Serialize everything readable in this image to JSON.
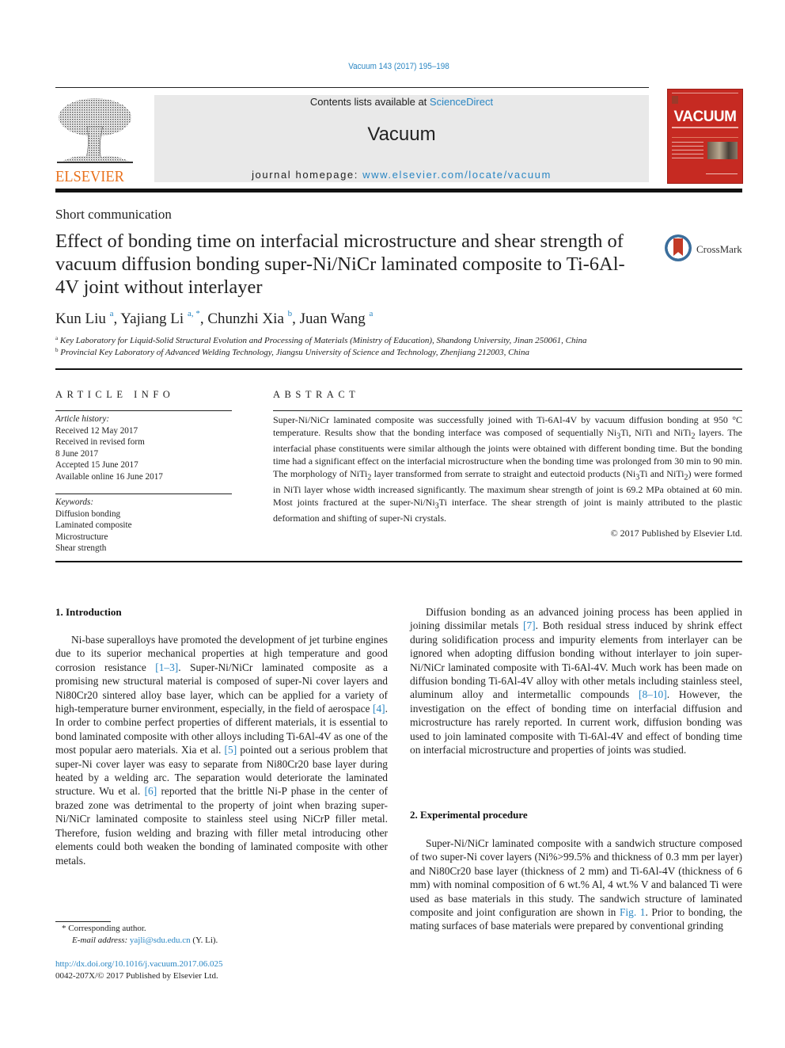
{
  "header": {
    "citation": "Vacuum 143 (2017) 195–198",
    "contents_prefix": "Contents lists available at ",
    "contents_link": "ScienceDirect",
    "journal_name": "Vacuum",
    "homepage_prefix": "journal homepage: ",
    "homepage_link": "www.elsevier.com/locate/vacuum",
    "publisher_wordmark": "ELSEVIER",
    "cover_title": "VACUUM",
    "crossmark_label": "CrossMark"
  },
  "colors": {
    "link": "#2a86c3",
    "elsevier_orange": "#e9711c",
    "cover_red": "#c62a22",
    "masthead_gray": "#e9e9e9"
  },
  "article": {
    "section_type": "Short communication",
    "title": "Effect of bonding time on interfacial microstructure and shear strength of vacuum diffusion bonding super-Ni/NiCr laminated composite to Ti-6Al-4V joint without interlayer",
    "authors": [
      {
        "name": "Kun Liu",
        "sup": "a"
      },
      {
        "name": "Yajiang Li",
        "sup": "a, *"
      },
      {
        "name": "Chunzhi Xia",
        "sup": "b"
      },
      {
        "name": "Juan Wang",
        "sup": "a"
      }
    ],
    "affiliations": [
      {
        "mark": "a",
        "text": "Key Laboratory for Liquid-Solid Structural Evolution and Processing of Materials (Ministry of Education), Shandong University, Jinan 250061, China"
      },
      {
        "mark": "b",
        "text": "Provincial Key Laboratory of Advanced Welding Technology, Jiangsu University of Science and Technology, Zhenjiang 212003, China"
      }
    ]
  },
  "article_info": {
    "heading": "ARTICLE INFO",
    "history_label": "Article history:",
    "history": [
      "Received 12 May 2017",
      "Received in revised form",
      "8 June 2017",
      "Accepted 15 June 2017",
      "Available online 16 June 2017"
    ],
    "keywords_label": "Keywords:",
    "keywords": [
      "Diffusion bonding",
      "Laminated composite",
      "Microstructure",
      "Shear strength"
    ]
  },
  "abstract": {
    "heading": "ABSTRACT",
    "parts": [
      "Super-Ni/NiCr laminated composite was successfully joined with Ti-6Al-4V by vacuum diffusion bonding at 950 °C temperature. Results show that the bonding interface was composed of sequentially Ni",
      "3",
      "Ti, NiTi and NiTi",
      "2",
      " layers. The interfacial phase constituents were similar although the joints were obtained with different bonding time. But the bonding time had a significant effect on the interfacial microstructure when the bonding time was prolonged from 30 min to 90 min. The morphology of NiTi",
      "2",
      " layer transformed from serrate to straight and eutectoid products (Ni",
      "3",
      "Ti and NiTi",
      "2",
      ") were formed in NiTi layer whose width increased significantly. The maximum shear strength of joint is 69.2 MPa obtained at 60 min. Most joints fractured at the super-Ni/Ni",
      "3",
      "Ti interface. The shear strength of joint is mainly attributed to the plastic deformation and shifting of super-Ni crystals."
    ],
    "copyright": "© 2017 Published by Elsevier Ltd."
  },
  "body": {
    "section1_heading": "1.  Introduction",
    "intro": [
      "Ni-base superalloys have promoted the development of jet turbine engines due to its superior mechanical properties at high temperature and good corrosion resistance ",
      "[1–3]",
      ". Super-Ni/NiCr laminated composite as a promising new structural material is composed of super-Ni cover layers and Ni80Cr20 sintered alloy base layer, which can be applied for a variety of high-temperature burner environment, especially, in the field of aerospace ",
      "[4]",
      ". In order to combine perfect properties of different materials, it is essential to bond laminated composite with other alloys including Ti-6Al-4V as one of the most popular aero materials. Xia et al. ",
      "[5]",
      " pointed out a serious problem that super-Ni cover layer was easy to separate from Ni80Cr20 base layer during heated by a welding arc. The separation would deteriorate the laminated structure. Wu et al. ",
      "[6]",
      " reported that the brittle Ni-P phase in the center of brazed zone was detrimental to the property of joint when brazing super-Ni/NiCr laminated composite to stainless steel using NiCrP filler metal. Therefore, fusion welding and brazing with filler metal introducing other elements could both weaken the bonding of laminated composite with other metals."
    ],
    "diffusion": [
      "Diffusion bonding as an advanced joining process has been applied in joining dissimilar metals ",
      "[7]",
      ". Both residual stress induced by shrink effect during solidification process and impurity elements from interlayer can be ignored when adopting diffusion bonding without interlayer to join super-Ni/NiCr laminated composite with Ti-6Al-4V. Much work has been made on diffusion bonding Ti-6Al-4V alloy with other metals including stainless steel, aluminum alloy and intermetallic compounds ",
      "[8–10]",
      ". However, the investigation on the effect of bonding time on interfacial diffusion and microstructure has rarely reported. In current work, diffusion bonding was used to join laminated composite with Ti-6Al-4V and effect of bonding time on interfacial microstructure and properties of joints was studied."
    ],
    "section2_heading": "2.  Experimental procedure",
    "experimental": [
      "Super-Ni/NiCr laminated composite with a sandwich structure composed of two super-Ni cover layers (Ni%>99.5% and thickness of 0.3 mm per layer) and Ni80Cr20 base layer (thickness of 2 mm) and Ti-6Al-4V (thickness of 6 mm) with nominal composition of 6 wt.% Al, 4 wt.% V and balanced Ti were used as base materials in this study. The sandwich structure of laminated composite and joint configuration are shown in ",
      "Fig. 1",
      ". Prior to bonding, the mating surfaces of base materials were prepared by conventional grinding"
    ]
  },
  "footnotes": {
    "corresponding": "* Corresponding author.",
    "email_label": "E-mail address: ",
    "email": "yajli@sdu.edu.cn",
    "email_suffix": " (Y. Li).",
    "doi": "http://dx.doi.org/10.1016/j.vacuum.2017.06.025",
    "issn": "0042-207X/© 2017 Published by Elsevier Ltd."
  }
}
